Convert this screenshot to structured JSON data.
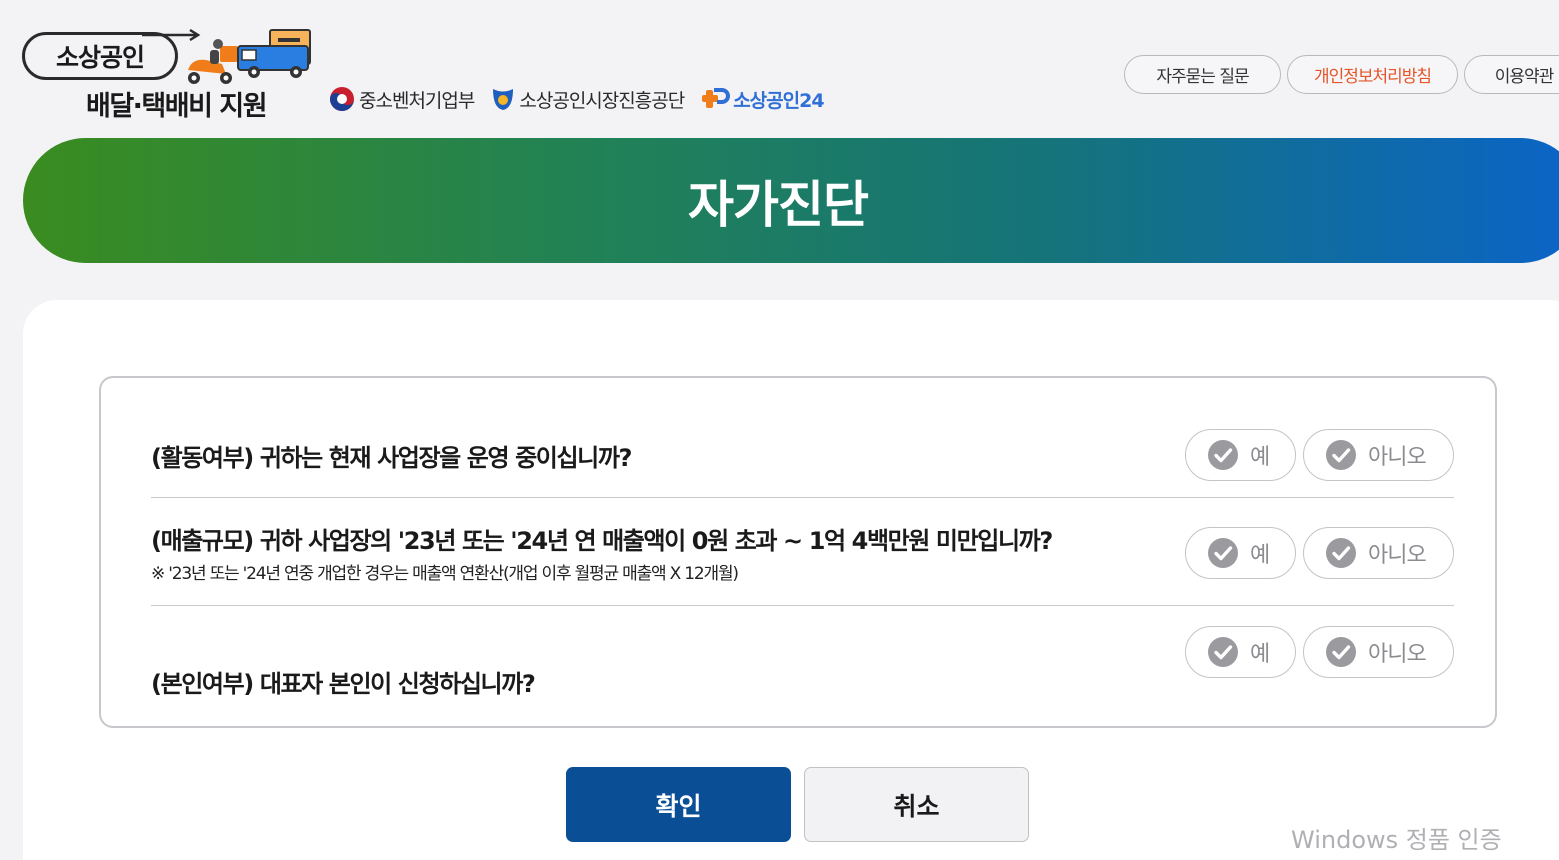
{
  "header": {
    "logo_title": "소상공인",
    "logo_subtitle": "배달·택배비 지원",
    "orgs": [
      "중소벤처기업부",
      "소상공인시장진흥공단",
      "소상공인24"
    ],
    "links": [
      "자주묻는 질문",
      "개인정보처리방침",
      "이용약관"
    ]
  },
  "banner": {
    "title": "자가진단"
  },
  "questions": [
    {
      "text": "(활동여부) 귀하는 현재 사업장을 운영 중이십니까?",
      "note": "",
      "yes_label": "예",
      "no_label": "아니오"
    },
    {
      "text": "(매출규모) 귀하 사업장의 '23년 또는 '24년 연 매출액이 0원 초과 ~ 1억 4백만원 미만입니까?",
      "note": "※ '23년 또는 '24년 연중 개업한 경우는 매출액 연환산(개업 이후 월평균 매출액 X 12개월)",
      "yes_label": "예",
      "no_label": "아니오"
    },
    {
      "text": "(본인여부) 대표자 본인이 신청하십니까?",
      "note": "",
      "yes_label": "예",
      "no_label": "아니오"
    }
  ],
  "buttons": {
    "confirm": "확인",
    "cancel": "취소"
  },
  "watermark": "Windows 정품 인증",
  "colors": {
    "primary_button": "#0a4f96",
    "banner_start": "#3a8c1f",
    "banner_end": "#0b64c8",
    "link_highlight": "#e4562a"
  }
}
